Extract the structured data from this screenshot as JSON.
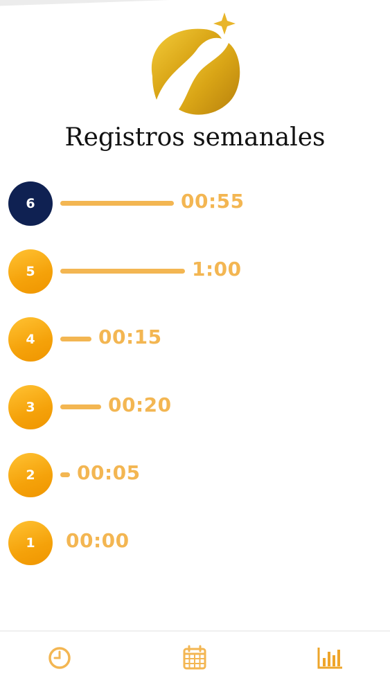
{
  "header": {
    "title": "Registros semanales"
  },
  "colors": {
    "accent": "#F3B652",
    "circle_orange": "#F5A20A",
    "active_circle": "#0F2152"
  },
  "weekly_records": [
    {
      "day": "6",
      "time": "00:55",
      "bar_fraction": 0.91,
      "active": true
    },
    {
      "day": "5",
      "time": "1:00",
      "bar_fraction": 1.0,
      "active": false
    },
    {
      "day": "4",
      "time": "00:15",
      "bar_fraction": 0.25,
      "active": false
    },
    {
      "day": "3",
      "time": "00:20",
      "bar_fraction": 0.33,
      "active": false
    },
    {
      "day": "2",
      "time": "00:05",
      "bar_fraction": 0.08,
      "active": false
    },
    {
      "day": "1",
      "time": "00:00",
      "bar_fraction": 0.0,
      "active": false
    }
  ],
  "bottom_nav": {
    "items": [
      {
        "icon": "clock-icon"
      },
      {
        "icon": "calendar-icon"
      },
      {
        "icon": "bar-chart-icon",
        "selected": true
      }
    ]
  }
}
